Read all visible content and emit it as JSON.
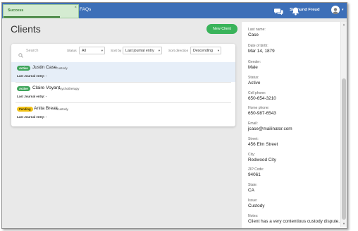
{
  "toast": {
    "message": "Success",
    "close_glyph": "×",
    "progress": 0.75
  },
  "nav": {
    "faqs_label": "FAQs",
    "chat_icon": "chat-bubbles-icon",
    "notification_icon": "bell-icon",
    "user_name": "Sigmund Freud",
    "caret": "▾"
  },
  "page": {
    "title": "Clients",
    "new_client_label": "New Client"
  },
  "filters": {
    "search_placeholder": "Search",
    "status_label": "Status",
    "status_value": "All",
    "sort_by_label": "Sort by",
    "sort_by_value": "Last journal entry",
    "sort_direction_label": "Sort direction",
    "sort_direction_value": "Descending",
    "caret": "▾"
  },
  "clients": [
    {
      "status": "Active",
      "name": "Justin Case",
      "type": "Custody",
      "last_entry": "Last Journal entry: -"
    },
    {
      "status": "Active",
      "name": "Claire Voyant",
      "type": "Psychotherapy",
      "last_entry": "Last Journal entry: -"
    },
    {
      "status": "Pending",
      "name": "Anita Break",
      "type": "Custody",
      "last_entry": "Last Journal entry: -"
    }
  ],
  "detail": {
    "fields": [
      {
        "label": "Last name:",
        "value": "Case"
      },
      {
        "label": "Date of birth:",
        "value": "Mar 14, 1879"
      },
      {
        "label": "Gender:",
        "value": "Male"
      },
      {
        "label": "Status:",
        "value": "Active"
      },
      {
        "label": "Cell phone:",
        "value": "650-654-3210"
      },
      {
        "label": "Home phone:",
        "value": "650-987-6543"
      },
      {
        "label": "Email:",
        "value": "jcase@mailinator.com"
      },
      {
        "label": "Street:",
        "value": "456 Elm Street"
      },
      {
        "label": "City:",
        "value": "Redwood City"
      },
      {
        "label": "ZIP Code:",
        "value": "94061"
      },
      {
        "label": "State:",
        "value": "CA"
      },
      {
        "label": "Issue:",
        "value": "Custody"
      },
      {
        "label": "Notes:",
        "value": "Client has a very contentious custody dispute."
      }
    ],
    "scroll_up": "▲",
    "scroll_down": "▼"
  },
  "colors": {
    "topbar": "#3d6fb8",
    "primary_button": "#39b35a",
    "status_active": "#3fa55b",
    "status_pending": "#f2c318",
    "toast_background": "#d4ebd1",
    "selected_row": "#e6eef8"
  }
}
